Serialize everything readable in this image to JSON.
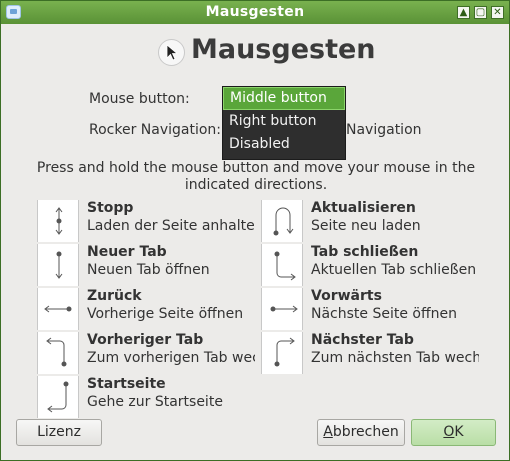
{
  "window": {
    "title": "Mausgesten",
    "controls": {
      "shade": "▲",
      "maximize": "▢",
      "close": "✕"
    }
  },
  "header": {
    "title": "Mausgesten",
    "icon": "mouse-cursor-icon"
  },
  "settings": {
    "mouse_button_label": "Mouse button:",
    "rocker_label": "Rocker Navigation:",
    "rocker_value_partial": "Navigation"
  },
  "dropdown": {
    "options": [
      "Middle button",
      "Right button",
      "Disabled"
    ],
    "selected": "Middle button"
  },
  "instruction": {
    "line1": "Press and hold the mouse button and move your mouse in the",
    "line2": "indicated directions."
  },
  "gestures": [
    {
      "title": "Stopp",
      "desc": "Laden der Seite anhalten",
      "icon": "arrow-down-up-icon"
    },
    {
      "title": "Aktualisieren",
      "desc": "Seite neu laden",
      "icon": "arrow-down-up-loop-icon"
    },
    {
      "title": "Neuer Tab",
      "desc": "Neuen Tab öffnen",
      "icon": "arrow-down-icon"
    },
    {
      "title": "Tab schließen",
      "desc": "Aktuellen Tab schließen",
      "icon": "arrow-down-right-icon"
    },
    {
      "title": "Zurück",
      "desc": "Vorherige Seite öffnen",
      "icon": "arrow-left-icon"
    },
    {
      "title": "Vorwärts",
      "desc": "Nächste Seite öffnen",
      "icon": "arrow-right-icon"
    },
    {
      "title": "Vorheriger Tab",
      "desc": "Zum vorherigen Tab wechseln",
      "icon": "arrow-up-left-icon"
    },
    {
      "title": "Nächster Tab",
      "desc": "Zum nächsten Tab wechseln",
      "icon": "arrow-up-right-icon"
    },
    {
      "title": "Startseite",
      "desc": "Gehe zur Startseite",
      "icon": "arrow-up-left-down-icon"
    }
  ],
  "buttons": {
    "license": "Lizenz",
    "cancel": "Abbrechen",
    "cancel_accel": "A",
    "cancel_rest": "bbrechen",
    "ok": "OK",
    "ok_accel": "O",
    "ok_rest": "K"
  },
  "colors": {
    "titlebar": "#5a9236",
    "selection": "#5aa63a",
    "dropdown_bg": "#2e2e2e",
    "ok_button": "#b9dea6"
  }
}
